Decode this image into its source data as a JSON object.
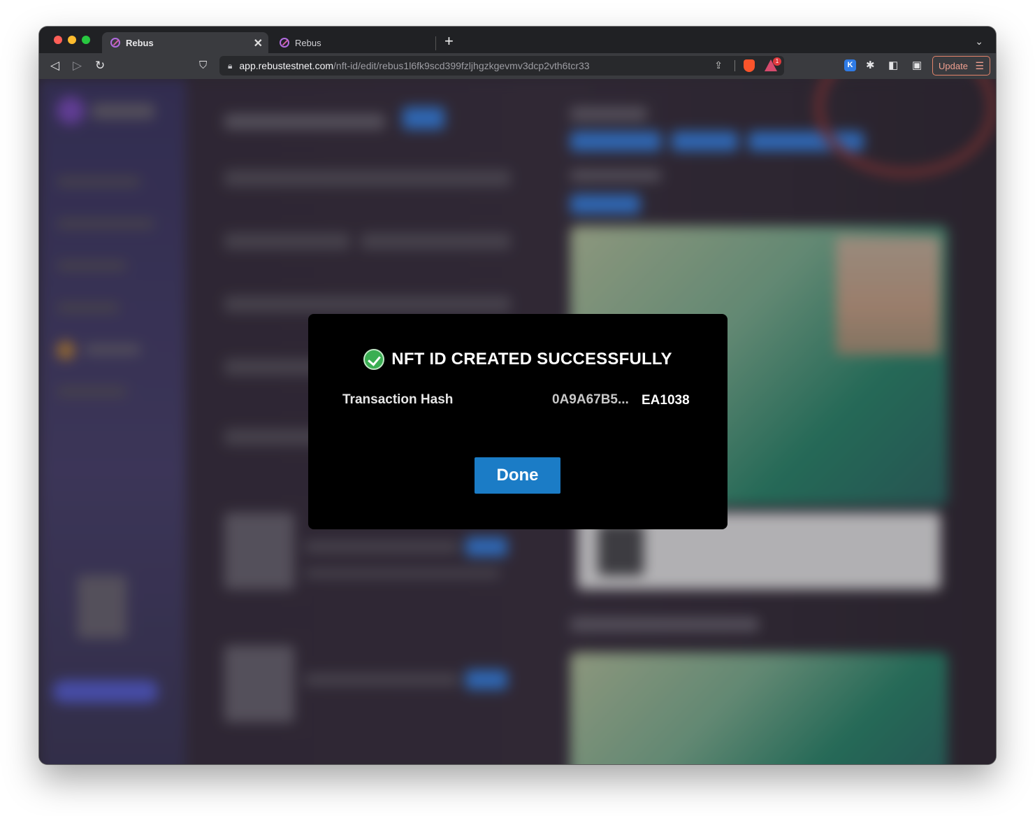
{
  "tabs": [
    {
      "title": "Rebus",
      "active": true
    },
    {
      "title": "Rebus",
      "active": false
    }
  ],
  "address_bar": {
    "host": "app.rebustestnet.com",
    "path": "/nft-id/edit/rebus1l6fk9scd399fzljhgzkgevmv3dcp2vth6tcr33"
  },
  "toolbar": {
    "update_label": "Update",
    "rewards_badge": "1",
    "extension_k": "K"
  },
  "modal": {
    "title": "NFT ID CREATED SUCCESSFULLY",
    "hash_label": "Transaction Hash",
    "hash_start": "0A9A67B5...",
    "hash_end": "EA1038",
    "done_label": "Done"
  },
  "colors": {
    "done_button": "#1b7cc6",
    "success_check": "#3aae52",
    "modal_bg": "#000000",
    "update_border": "#e2836a"
  }
}
